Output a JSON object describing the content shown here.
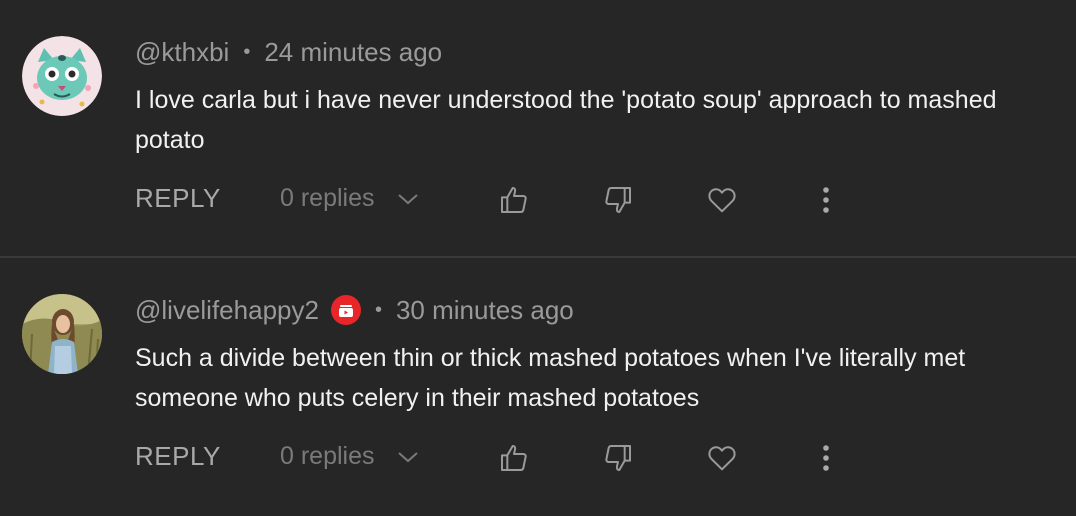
{
  "comments": [
    {
      "username": "@kthxbi",
      "separator": "•",
      "time": "24 minutes ago",
      "text": "I love carla but i have never understood the 'potato soup' approach to mashed potato",
      "reply_label": "REPLY",
      "replies_label": "0 replies",
      "avatar_icon": "cat-illustration-avatar"
    },
    {
      "username": "@livelifehappy2",
      "separator": "•",
      "time": "30 minutes ago",
      "text": "Such a divide between thin or thick mashed potatoes when I've literally met someone who puts celery in their mashed potatoes",
      "reply_label": "REPLY",
      "replies_label": "0 replies",
      "avatar_icon": "person-photo-avatar",
      "badge_icon": "subscriber-badge-icon",
      "badge_color": "#e8262a"
    }
  ],
  "colors": {
    "background": "#262626",
    "divider": "#3a3a3a",
    "text": "#f1f1f1",
    "meta": "#9a9a9a",
    "muted": "#7a7a7a"
  }
}
